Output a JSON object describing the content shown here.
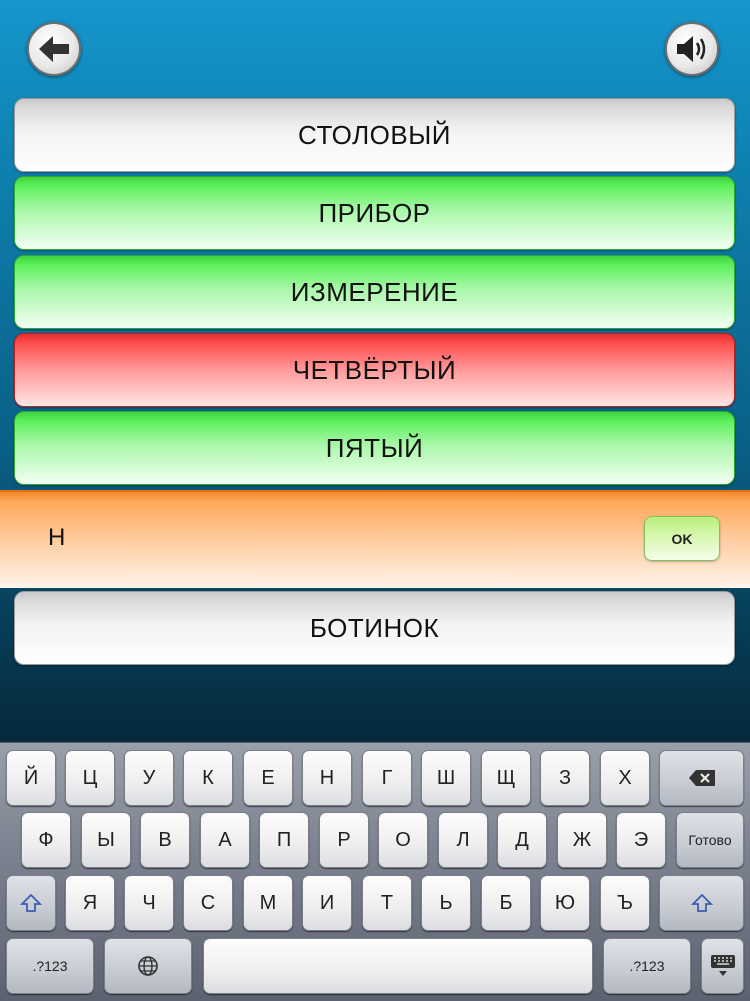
{
  "header": {
    "back_icon": "arrow-left-icon",
    "sound_icon": "speaker-icon"
  },
  "words": [
    {
      "label": "СТОЛОВЫЙ",
      "state": "neutral"
    },
    {
      "label": "ПРИБОР",
      "state": "correct"
    },
    {
      "label": "ИЗМЕРЕНИЕ",
      "state": "correct"
    },
    {
      "label": "ЧЕТВЁРТЫЙ",
      "state": "wrong"
    },
    {
      "label": "ПЯТЫЙ",
      "state": "correct"
    }
  ],
  "input": {
    "value": "Н",
    "ok_label": "OK"
  },
  "extra_word": {
    "label": "БОТИНОК",
    "state": "neutral"
  },
  "keyboard": {
    "row1": [
      "Й",
      "Ц",
      "У",
      "К",
      "Е",
      "Н",
      "Г",
      "Ш",
      "Щ",
      "З",
      "Х"
    ],
    "row2": [
      "Ф",
      "Ы",
      "В",
      "А",
      "П",
      "Р",
      "О",
      "Л",
      "Д",
      "Ж",
      "Э"
    ],
    "row3": [
      "Я",
      "Ч",
      "С",
      "М",
      "И",
      "Т",
      "Ь",
      "Б",
      "Ю",
      "Ъ"
    ],
    "done_label": "Готово",
    "numbers_label": ".?123",
    "backspace_icon": "backspace-icon",
    "shift_icon": "shift-icon",
    "globe_icon": "globe-icon",
    "hide_keyboard_icon": "keyboard-hide-icon"
  },
  "colors": {
    "correct": "#5bf05b",
    "wrong": "#ff5050",
    "neutral": "#f3f3f3",
    "input_band": "#ffa85a"
  }
}
